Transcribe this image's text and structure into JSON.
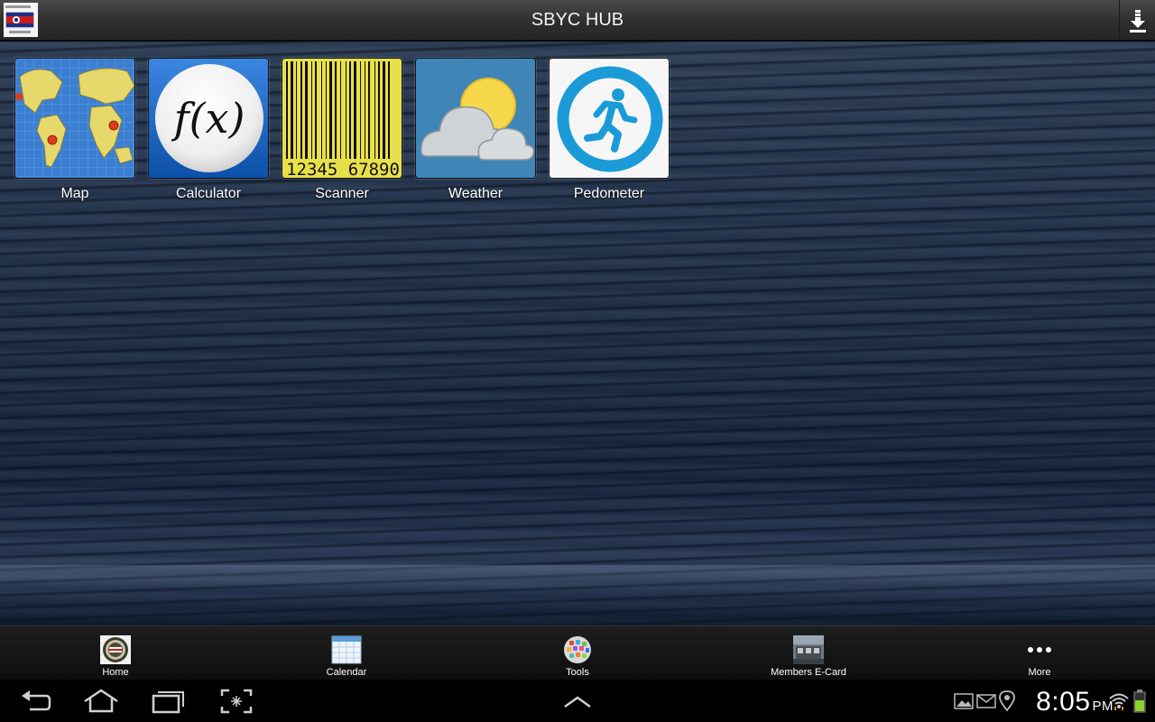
{
  "header": {
    "title": "SBYC HUB",
    "logo_icon": "yacht-club-burgee-icon",
    "download_icon": "download-icon"
  },
  "tiles": [
    {
      "label": "Map",
      "icon": "world-map-icon"
    },
    {
      "label": "Calculator",
      "icon": "fx-calculator-icon"
    },
    {
      "label": "Scanner",
      "icon": "barcode-scanner-icon",
      "barcode_text": "12345 67890"
    },
    {
      "label": "Weather",
      "icon": "partly-cloudy-icon"
    },
    {
      "label": "Pedometer",
      "icon": "runner-icon"
    }
  ],
  "calculator": {
    "symbol": "f(x)"
  },
  "tabs": [
    {
      "label": "Home",
      "icon": "club-seal-icon"
    },
    {
      "label": "Calendar",
      "icon": "calendar-icon"
    },
    {
      "label": "Tools",
      "icon": "apps-globe-icon"
    },
    {
      "label": "Members E-Card",
      "icon": "clubhouse-photo-icon"
    },
    {
      "label": "More",
      "icon": "more-dots-icon"
    }
  ],
  "system": {
    "time": "8:05",
    "ampm": "PM"
  },
  "colors": {
    "pedometer_blue": "#1a9bd7",
    "scanner_yellow": "#e8e04a",
    "weather_blue": "#3f86b7",
    "map_water": "#3b7fd1",
    "map_land": "#e6d86a",
    "pin_red": "#e03a1a"
  }
}
